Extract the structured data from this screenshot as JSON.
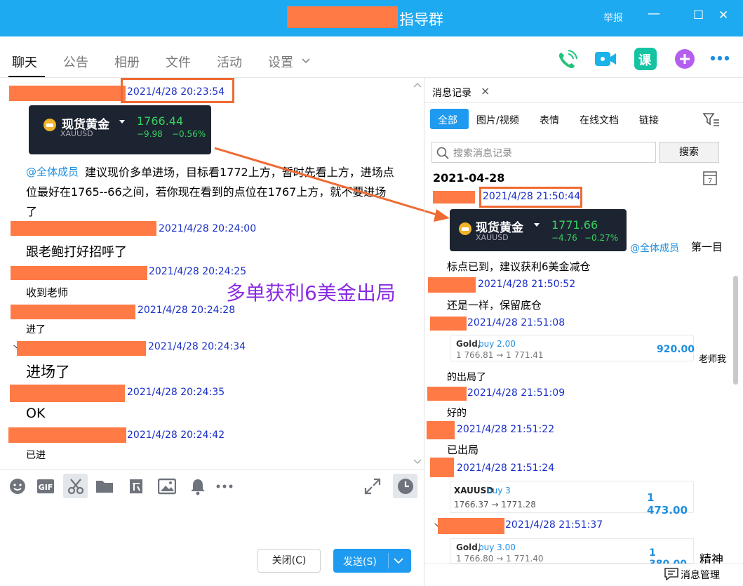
{
  "window": {
    "title_suffix": "指导群",
    "report_label": "举报",
    "minimize_glyph": "—",
    "maximize_glyph": "☐",
    "close_glyph": "✕"
  },
  "nav_tabs": [
    {
      "label": "聊天",
      "active": true
    },
    {
      "label": "公告"
    },
    {
      "label": "相册"
    },
    {
      "label": "文件"
    },
    {
      "label": "活动"
    },
    {
      "label": "设置"
    }
  ],
  "header_icons": [
    "phone-call-icon",
    "video-call-icon",
    "course-icon",
    "add-app-icon",
    "more-icon"
  ],
  "chat": {
    "messages": [
      {
        "time": "2021/4/28 20:23:54"
      },
      {
        "card": {
          "name": "现货黄金",
          "symbol": "XAUUSD",
          "price": "1766.44",
          "change": "−9.98",
          "change_pct": "−0.56%"
        }
      },
      {
        "mention": "@全体成员",
        "text_line1": "建议现价多单进场，目标看1772上方，暂时先看上方，进场点",
        "text_line2": "位最好在1765--66之间，若你现在看到的点位在1767上方，就不要进场",
        "text_line3": "了"
      },
      {
        "time": "2021/4/28 20:24:00",
        "text": "跟老鲍打好招呼了"
      },
      {
        "time": "2021/4/28 20:24:25",
        "text": "收到老师"
      },
      {
        "time": "2021/4/28 20:24:28",
        "text": "进了"
      },
      {
        "time": "2021/4/28 20:24:34",
        "prefix": "丶",
        "text": "进场了"
      },
      {
        "time": "2021/4/28 20:24:35",
        "text": "OK"
      },
      {
        "time": "2021/4/28 20:24:42",
        "text": "已进"
      }
    ],
    "overlay_text": "多单获利6美金出局",
    "overlay_color": "#8a2be2",
    "accent_box_color": "#ef6a32"
  },
  "composer": {
    "close_label": "关闭(C)",
    "send_label": "发送(S)",
    "toolbar_icons": [
      "emoji-icon",
      "gif-icon",
      "scissors-icon",
      "folder-icon",
      "document-icon",
      "image-icon",
      "bell-icon",
      "more-icon"
    ]
  },
  "history": {
    "panel_title": "消息记录",
    "close_glyph": "×",
    "filters": [
      "全部",
      "图片/视频",
      "表情",
      "在线文档",
      "链接"
    ],
    "search_placeholder": "搜索消息记录",
    "search_button": "搜索",
    "date_header": "2021-04-28",
    "entries": [
      {
        "time": "2021/4/28 21:50:44"
      },
      {
        "card": {
          "name": "现货黄金",
          "symbol": "XAUUSD",
          "price": "1771.66",
          "change": "−4.76",
          "change_pct": "−0.27%"
        },
        "mention": "@全体成员",
        "mention_tail": "第一目"
      },
      {
        "text": "标点已到，建议获利6美金减仓"
      },
      {
        "time": "2021/4/28 21:50:52",
        "text": "还是一样，保留底仓"
      },
      {
        "time": "2021/4/28 21:51:08"
      },
      {
        "trade": {
          "symbol": "Gold,",
          "side": "buy 2.00",
          "range": "1 766.81 → 1 771.41",
          "profit": "920.00"
        },
        "side_text": "老师我"
      },
      {
        "text": "的出局了"
      },
      {
        "time": "2021/4/28 21:51:09",
        "text": "好的"
      },
      {
        "time": "2021/4/28 21:51:22",
        "text": "已出局"
      },
      {
        "time": "2021/4/28 21:51:24"
      },
      {
        "trade": {
          "symbol": "XAUUSD",
          "side": "buy 3",
          "range": "1766.37 → 1771.28",
          "profit": "1 473.00"
        }
      },
      {
        "time": "2021/4/28 21:51:37",
        "prefix": "丶"
      },
      {
        "trade": {
          "symbol": "Gold,",
          "side": "buy 3.00",
          "range": "1 766.80 → 1 771.40",
          "profit": "1 380.00"
        },
        "side_text": "精神"
      }
    ],
    "manage_label": "消息管理"
  }
}
